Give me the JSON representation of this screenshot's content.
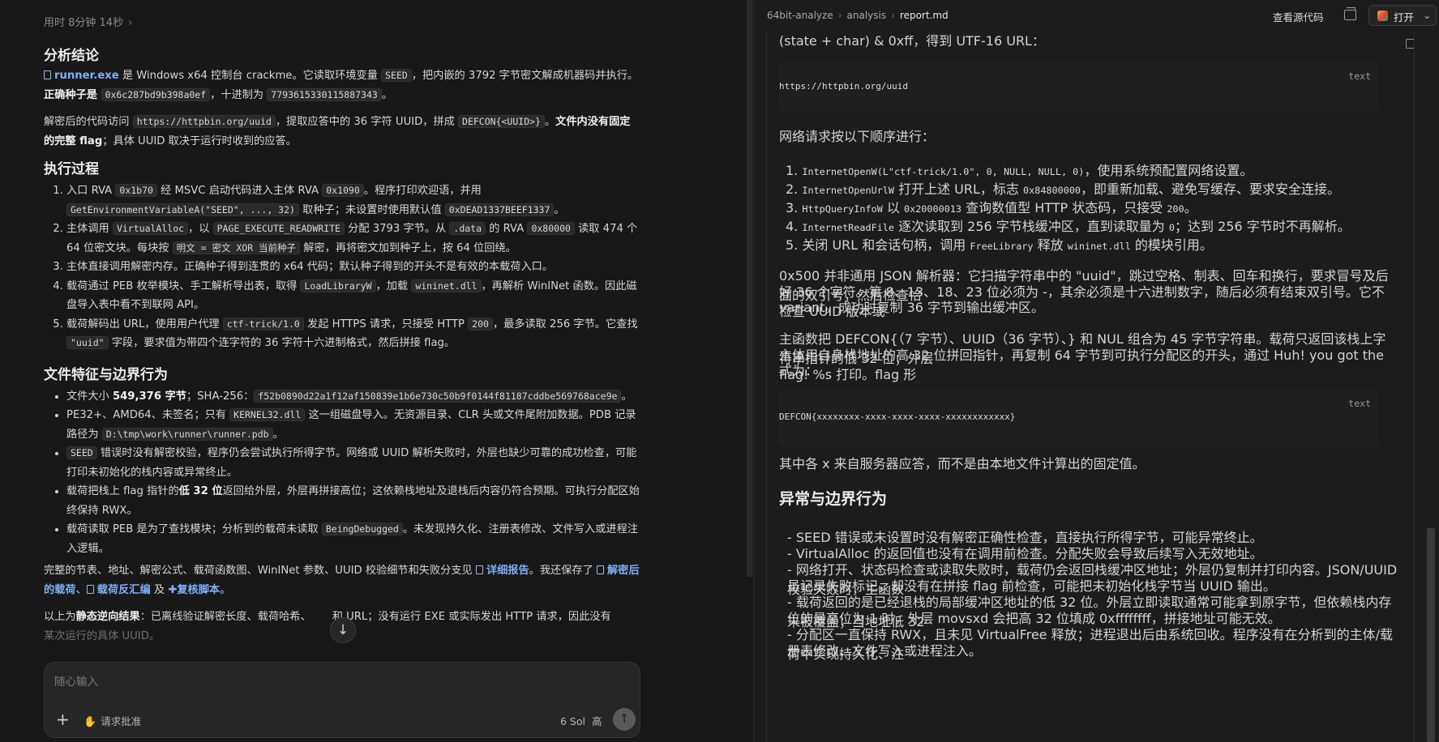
{
  "left": {
    "elapsed": "用时 8分钟 14秒",
    "sections": {
      "conclusion_title": "分析结论",
      "conclusion_p1": {
        "file": "runner.exe",
        "t1": " 是 Windows x64 控制台 crackme。它读取环境变量 ",
        "c1": "SEED",
        "t2": "，把内嵌的 3792 字节密文解成机器码并执行。",
        "b1": "正确种子是 ",
        "c2": "0x6c287bd9b398a0ef",
        "t3": "，十进制为 ",
        "c3": "7793615330115887343",
        "t4": "。"
      },
      "conclusion_p2": {
        "t1": "解密后的代码访问 ",
        "c1": "https://httpbin.org/uuid",
        "t2": "，提取应答中的 36 字符 UUID，拼成 ",
        "c2": "DEFCON{<UUID>}",
        "t3": "。",
        "b1": "文件内没有固定的完整 flag",
        "t4": "；具体 UUID 取决于运行时收到的应答。"
      },
      "process_title": "执行过程",
      "process": [
        {
          "t1": "入口 RVA ",
          "c1": "0x1b70",
          "t2": " 经 MSVC 启动代码进入主体 RVA ",
          "c2": "0x1090",
          "t3": "。程序打印欢迎语，并用 ",
          "c3": "GetEnvironmentVariableA(\"SEED\", ..., 32)",
          "t4": " 取种子；未设置时使用默认值 ",
          "c4": "0xDEAD1337BEEF1337",
          "t5": "。"
        },
        {
          "t1": "主体调用 ",
          "c1": "VirtualAlloc",
          "t2": "，以 ",
          "c2": "PAGE_EXECUTE_READWRITE",
          "t3": " 分配 3793 字节。从 ",
          "c3": ".data",
          "t4": " 的 RVA ",
          "c4": "0x80000",
          "t5": " 读取 474 个 64 位密文块。每块按 ",
          "c5": "明文 = 密文 XOR 当前种子",
          "t6": " 解密，再将密文加到种子上，按 64 位回绕。"
        },
        {
          "t1": "主体直接调用解密内存。正确种子得到连贯的 x64 代码；默认种子得到的开头不是有效的本载荷入口。"
        },
        {
          "t1": "载荷通过 PEB 枚举模块、手工解析导出表，取得 ",
          "c1": "LoadLibraryW",
          "t2": "，加载 ",
          "c2": "wininet.dll",
          "t3": "，再解析 WinINet 函数。因此磁盘导入表中看不到联网 API。"
        },
        {
          "t1": "载荷解码出 URL，使用用户代理 ",
          "c1": "ctf-trick/1.0",
          "t2": " 发起 HTTPS 请求，只接受 HTTP ",
          "c2": "200",
          "t3": "，最多读取 256 字节。它查找 ",
          "c3": "\"uuid\"",
          "t4": " 字段，要求值为带四个连字符的 36 字符十六进制格式，然后拼接 flag。"
        }
      ],
      "features_title": "文件特征与边界行为",
      "features": [
        {
          "t1": "文件大小 ",
          "b1": "549,376 字节",
          "t2": "；SHA-256：",
          "c1": "f52b0890d22a1f12af150839e1b6e730c50b9f0144f81187cddbe569768ace9e",
          "t3": "。"
        },
        {
          "t1": "PE32+、AMD64、未签名；只有 ",
          "c1": "KERNEL32.dll",
          "t2": " 这一组磁盘导入。无资源目录、CLR 头或文件尾附加数据。PDB 记录路径为 ",
          "c2": "D:\\tmp\\work\\runner\\runner.pdb",
          "t3": "。"
        },
        {
          "c1": "SEED",
          "t1": " 错误时没有解密校验，程序仍会尝试执行所得字节。网络或 UUID 解析失败时，外层也缺少可靠的成功检查，可能打印未初始化的栈内容或异常终止。"
        },
        {
          "t1": "载荷把栈上 flag 指针的",
          "b1": "低 32 位",
          "t2": "返回给外层，外层再拼接高位；这依赖栈地址及退栈后内容仍符合预期。可执行分配区始终保持 RWX。"
        },
        {
          "t1": "载荷读取 PEB 是为了查找模块；分析到的载荷未读取 ",
          "c1": "BeingDebugged",
          "t2": "。未发现持久化、注册表修改、文件写入或进程注入逻辑。"
        }
      ],
      "summary": {
        "t1": "完整的节表、地址、解密公式、载荷函数图、WinINet 参数、UUID 校验细节和失败分支见 ",
        "l1": "详细报告",
        "t2": "。我还保存了 ",
        "l2": "解密后的载荷",
        "t3": "、",
        "l3": "载荷反汇编",
        "t4": " 及 ",
        "l4": "复核脚本",
        "t5": "。"
      },
      "final": {
        "t1": "以上为",
        "b1": "静态逆向结果",
        "t2": "：已离线验证解密长度、载荷哈希、",
        "t3": "和 URL；没有运行 EXE 或实际发出 HTTP 请求，因此没有",
        "t4": "某次运行的具体 UUID。"
      }
    },
    "composer": {
      "placeholder": "随心输入",
      "approval": "请求批准",
      "model": "6 Sol",
      "level": "高"
    }
  },
  "right": {
    "breadcrumb": [
      "64bit-analyze",
      "analysis",
      "report.md"
    ],
    "view_source": "查看源代码",
    "open": "打开",
    "top_line": "(state + char) & 0xff，得到 UTF-16 URL：",
    "code1": {
      "lang": "text",
      "code": "https://httpbin.org/uuid"
    },
    "net_intro": "网络请求按以下顺序进行：",
    "net_steps": [
      {
        "n": "1.",
        "c": "InternetOpenW(L\"ctf-trick/1.0\", 0, NULL, NULL, 0)",
        "t": "，使用系统预配置网络设置。"
      },
      {
        "n": "2.",
        "c": "InternetOpenUrlW",
        "t": " 打开上述 URL，标志 ",
        "c2": "0x84800000",
        "t2": "，即重新加载、避免写缓存、要求安全连接。"
      },
      {
        "n": "3.",
        "c": "HttpQueryInfoW",
        "t": " 以 ",
        "c2": "0x20000013",
        "t2": " 查询数值型 HTTP 状态码，只接受 ",
        "c3": "200",
        "t3": "。"
      },
      {
        "n": "4.",
        "c": "InternetReadFile",
        "t": " 逐次读取到 256 字节栈缓冲区，直到读取量为 ",
        "c2": "0",
        "t2": "；达到 256 字节时不再解析。"
      },
      {
        "n": "5.",
        "t0": "关闭 URL 和会话句柄，调用 ",
        "c": "FreeLibrary",
        "t": " 释放 ",
        "c2": "wininet.dll",
        "t2": " 的模块引用。"
      }
    ],
    "parser_l1": "0x500 并非通用 JSON 解析器：它扫描字符串中的 \"uuid\"，跳过空格、制表、回车和换行，要求冒号及后面的双引号，然后检查恰",
    "parser_l2": "好 36 个字符。第 8、13、18、23 位必须为 -，其余必须是十六进制数字，随后必须有结束双引号。它不检查 UUID 版本或",
    "parser_l3": "variant。成功时复制 36 字节到输出缓冲区。",
    "combine_l1": "主函数把 DEFCON{（7 字节）、UUID（36 字节）、} 和 NUL 组合为 45 字节字符串。载荷只返回该栈上字符串指针的低 32 位；外层",
    "combine_l2": "主体用自身栈地址的高 32 位拼回指针，再复制 64 字节到可执行分配区的开头，通过 Huh! you got the flag! %s 打印。flag 形",
    "combine_l3": "式为：",
    "code2": {
      "lang": "text",
      "code": "DEFCON{xxxxxxxx-xxxx-xxxx-xxxx-xxxxxxxxxxxx}"
    },
    "x_note": "其中各 x 来自服务器应答，而不是由本地文件计算出的固定值。",
    "anomaly_title": "异常与边界行为",
    "anomalies": [
      "- SEED 错误或未设置时没有解密正确性检查，直接执行所得字节，可能异常终止。",
      "- VirtualAlloc 的返回值也没有在调用前检查。分配失败会导致后续写入无效地址。",
      "- 网络打开、状态码检查或读取失败时，载荷仍会返回栈缓冲区地址；外层仍复制并打印内容。JSON/UUID 校验失败时，主函数",
      "  虽记录失败标记，却没有在拼接 flag 前检查，可能把未初始化栈字节当 UUID 输出。",
      "- 载荷返回的是已经退栈的局部缓冲区地址的低 32 位。外层立即读取通常可能拿到原字节，但依赖栈内存未被覆盖；当地址低 32",
      "  位的最高位为 1 时，外层 movsxd 会把高 32 位填成 0xffffffff，拼接地址可能无效。",
      "- 分配区一直保持 RWX，且未见 VirtualFree 释放；进程退出后由系统回收。程序没有在分析到的主体/载荷中实现持久化、注",
      "  册表修改、文件写入或进程注入。"
    ]
  }
}
